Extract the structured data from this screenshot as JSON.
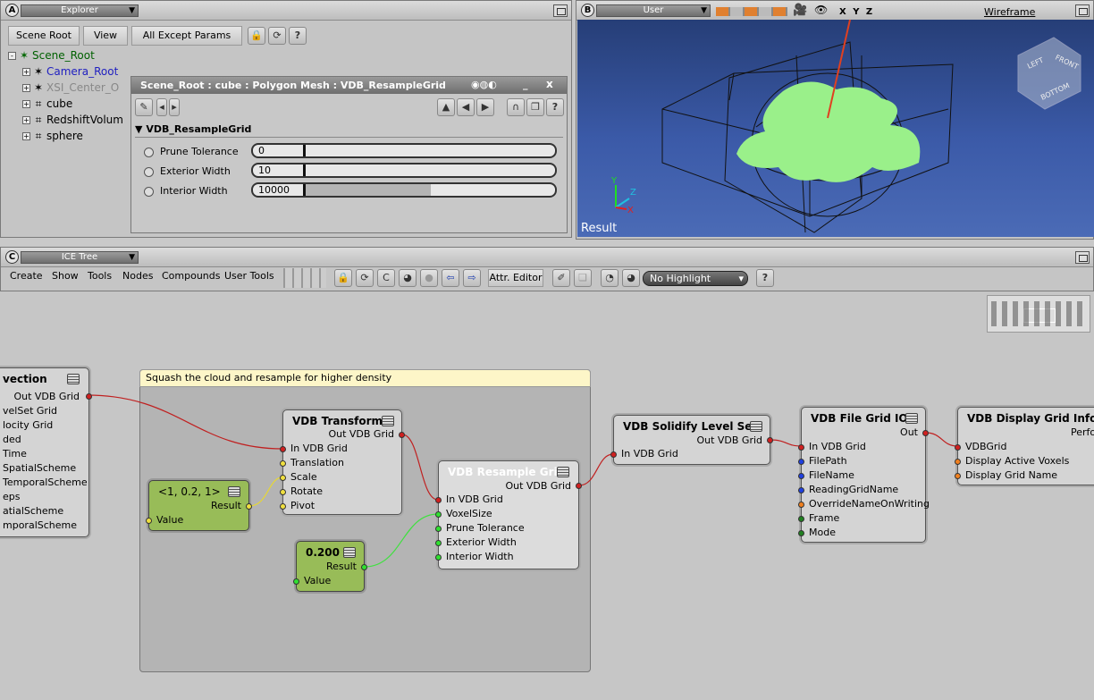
{
  "explorer": {
    "title": "Explorer",
    "scene_root_btn": "Scene Root",
    "view_btn": "View",
    "filter_btn": "All Except Params",
    "tree": [
      "Scene_Root",
      "Camera_Root",
      "XSI_Center_O",
      "cube",
      "RedshiftVolum",
      "sphere"
    ]
  },
  "ppg": {
    "title": "Scene_Root : cube : Polygon Mesh : VDB_ResampleGrid",
    "close": "x",
    "section": "VDB_ResampleGrid",
    "params": [
      {
        "label": "Prune Tolerance",
        "value": "0",
        "fill": 0.0
      },
      {
        "label": "Exterior Width",
        "value": "10",
        "fill": 0.0
      },
      {
        "label": "Interior Width",
        "value": "10000",
        "fill": 0.5
      }
    ]
  },
  "viewport": {
    "letter": "B",
    "camera": "User",
    "axes_label": "X Y Z",
    "mode": "Wireframe",
    "result_label": "Result",
    "cube_labels": [
      "LEFT",
      "FRONT",
      "BOTTOM"
    ],
    "axis_y": "Y",
    "axis_z": "Z",
    "axis_x": "X"
  },
  "ice": {
    "letter": "C",
    "title": "ICE Tree",
    "menus": [
      "Create",
      "Show",
      "Tools",
      "Nodes",
      "Compounds",
      "User Tools"
    ],
    "attr_editor": "Attr. Editor",
    "highlight": "No Highlight",
    "comment": "Squash the cloud and resample for higher density",
    "advection": {
      "title": "vection",
      "ports": [
        "Out VDB Grid",
        "velSet Grid",
        "locity Grid",
        "ded",
        "Time",
        "SpatialScheme",
        "TemporalScheme",
        "eps",
        "atialScheme",
        "mporalScheme"
      ]
    },
    "transform": {
      "title": "VDB Transform",
      "out": "Out VDB Grid",
      "ports": [
        "In VDB Grid",
        "Translation",
        "Scale",
        "Rotate",
        "Pivot"
      ]
    },
    "vector": {
      "title": "<1, 0.2, 1>",
      "result": "Result",
      "value": "Value"
    },
    "scalar": {
      "title": "0.200",
      "result": "Result",
      "value": "Value"
    },
    "resample": {
      "title": "VDB Resample Grid",
      "out": "Out VDB Grid",
      "ports": [
        "In VDB Grid",
        "VoxelSize",
        "Prune Tolerance",
        "Exterior Width",
        "Interior Width"
      ]
    },
    "solidify": {
      "title": "VDB Solidify Level Set",
      "out": "Out VDB Grid",
      "ports": [
        "In VDB Grid"
      ]
    },
    "fileio": {
      "title": "VDB File Grid IO",
      "out": "Out",
      "ports": [
        "In VDB Grid",
        "FilePath",
        "FileName",
        "ReadingGridName",
        "OverrideNameOnWriting",
        "Frame",
        "Mode"
      ]
    },
    "display": {
      "title": "VDB Display Grid Info",
      "extra": "Perfo",
      "ports": [
        "VDBGrid",
        "Display Active Voxels",
        "Display Grid Name"
      ]
    }
  },
  "colors": {
    "accent_green": "#98bc58",
    "wire_red": "#c02020",
    "wire_yellow": "#e8d830",
    "wire_green": "#40e040",
    "viewport_blue": "#3b5aa8",
    "comment_yellow": "#fdf6c8"
  }
}
